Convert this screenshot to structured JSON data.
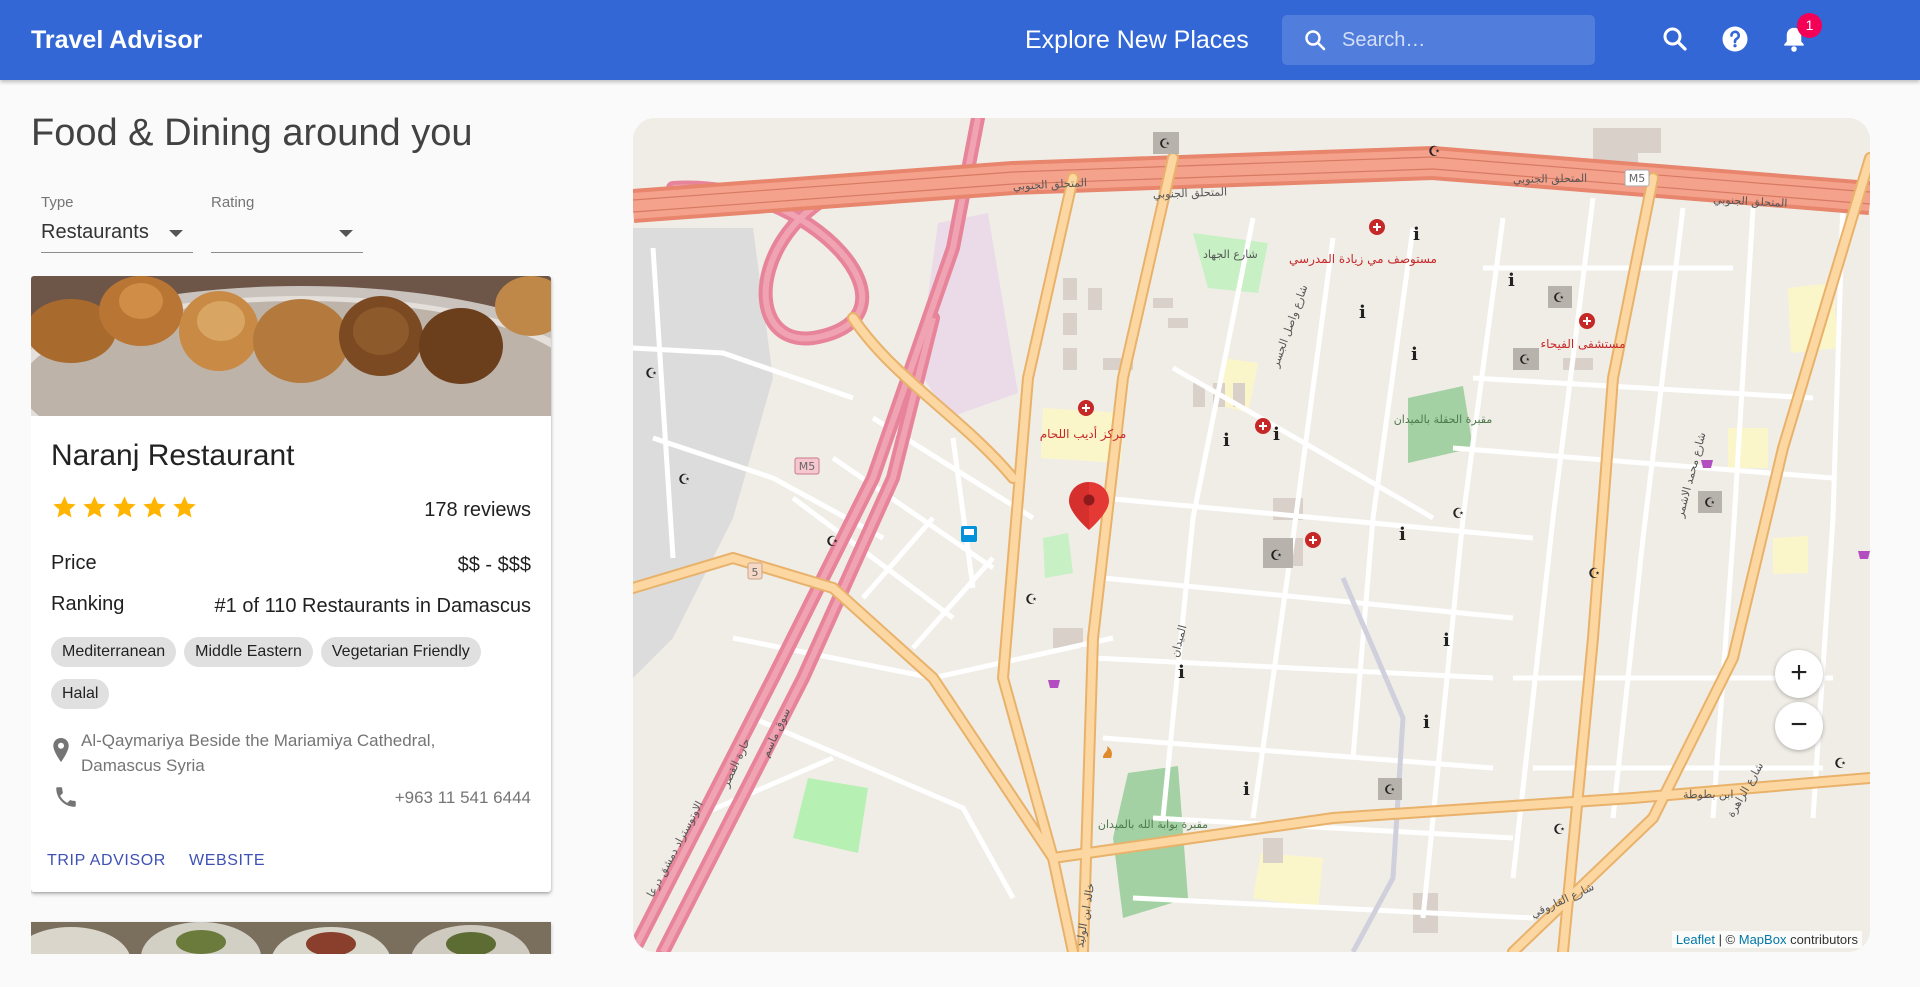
{
  "appbar": {
    "brand": "Travel Advisor",
    "explore_label": "Explore New Places",
    "search_placeholder": "Search…",
    "notification_count": "1"
  },
  "page": {
    "title": "Food & Dining around you"
  },
  "filters": {
    "type_label": "Type",
    "type_value": "Restaurants",
    "rating_label": "Rating",
    "rating_value": ""
  },
  "place": {
    "name": "Naranj Restaurant",
    "rating": 5,
    "reviews": "178 reviews",
    "price_label": "Price",
    "price_value": "$$ - $$$",
    "ranking_label": "Ranking",
    "ranking_value": "#1 of 110 Restaurants in Damascus",
    "cuisines": [
      "Mediterranean",
      "Middle Eastern",
      "Vegetarian Friendly",
      "Halal"
    ],
    "address": "Al-Qaymariya Beside the Mariamiya Cathedral, Damascus Syria",
    "phone": "+963 11 541 6444",
    "link_tripadvisor": "TRIP ADVISOR",
    "link_website": "WEBSITE"
  },
  "map": {
    "labels": [
      "المتحلق الجنوبي",
      "المتحلق الجنوبي",
      "المتحلق الجنوبي",
      "المتحلق الجنوبي",
      "M5",
      "M5",
      "5",
      "مستوصف مي زيادة المدرسي",
      "مستشفى الفيحاء",
      "مركز أديب اللحام",
      "مقبرة الحقلة بالميدان",
      "مقبرة بوابة الله بالميدان",
      "شارع الجهاد",
      "شارع الزاهرة",
      "شارع محمد الاشمر",
      "ابن بطوطة",
      "خالد ابن الوليد",
      "الاوتوستراد دمشق درعا",
      "سوق ماسم",
      "حارة القصر",
      "شارع القاروقي",
      "شارع واصل الجسر",
      "الميدان"
    ],
    "zoom_in": "+",
    "zoom_out": "−",
    "attribution_leaflet": "Leaflet",
    "attribution_sep": " | © ",
    "attribution_mapbox": "MapBox",
    "attribution_rest": " contributors"
  },
  "colors": {
    "appbar": "#3367d6",
    "badge": "#f50057",
    "star": "#ffb400",
    "link": "#3f51b5",
    "marker": "#e53935"
  }
}
